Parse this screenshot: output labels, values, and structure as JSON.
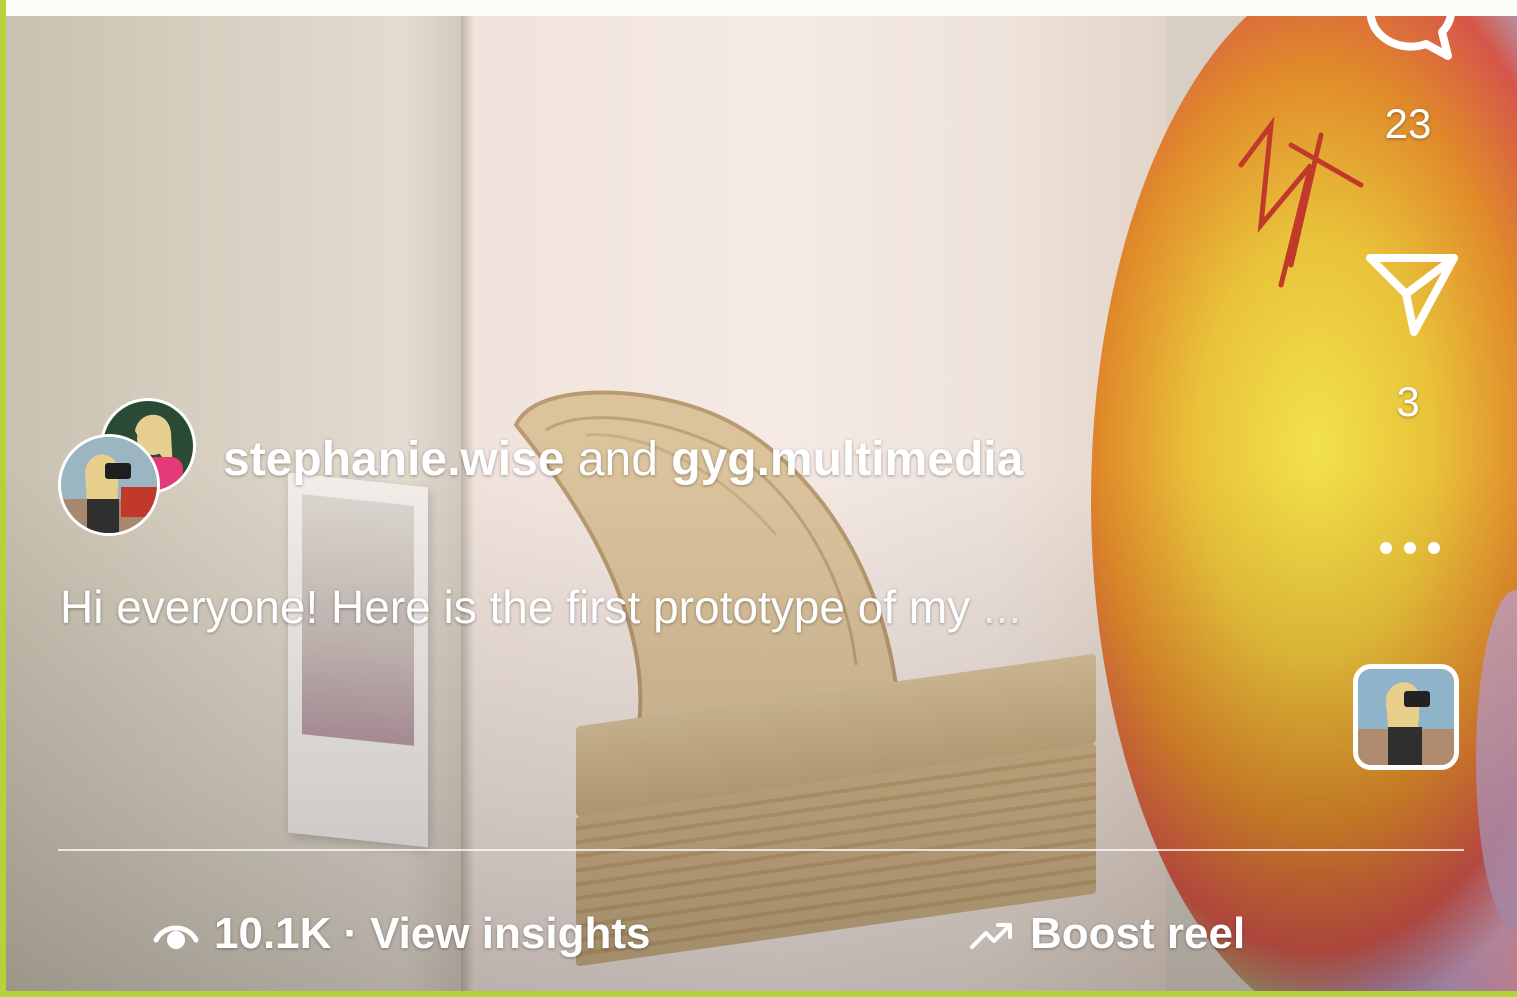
{
  "right_rail": {
    "comment_count": "23",
    "share_count": "3",
    "more_icon": "more-dots-icon",
    "comment_icon": "comment-bubble-icon",
    "share_icon": "paper-plane-icon"
  },
  "post": {
    "author_primary": "stephanie.wise",
    "connector": "and",
    "author_secondary": "gyg.multimedia",
    "caption": "Hi everyone! Here is the first prototype of my",
    "caption_more": "..."
  },
  "footer": {
    "eye_icon": "eye-icon",
    "views": "10.1K",
    "separator": "·",
    "insights_label": "View insights",
    "boost_icon": "trending-up-icon",
    "boost_label": "Boost reel"
  },
  "colors": {
    "outer_border": "#b6d23a",
    "text": "#ffffff"
  }
}
